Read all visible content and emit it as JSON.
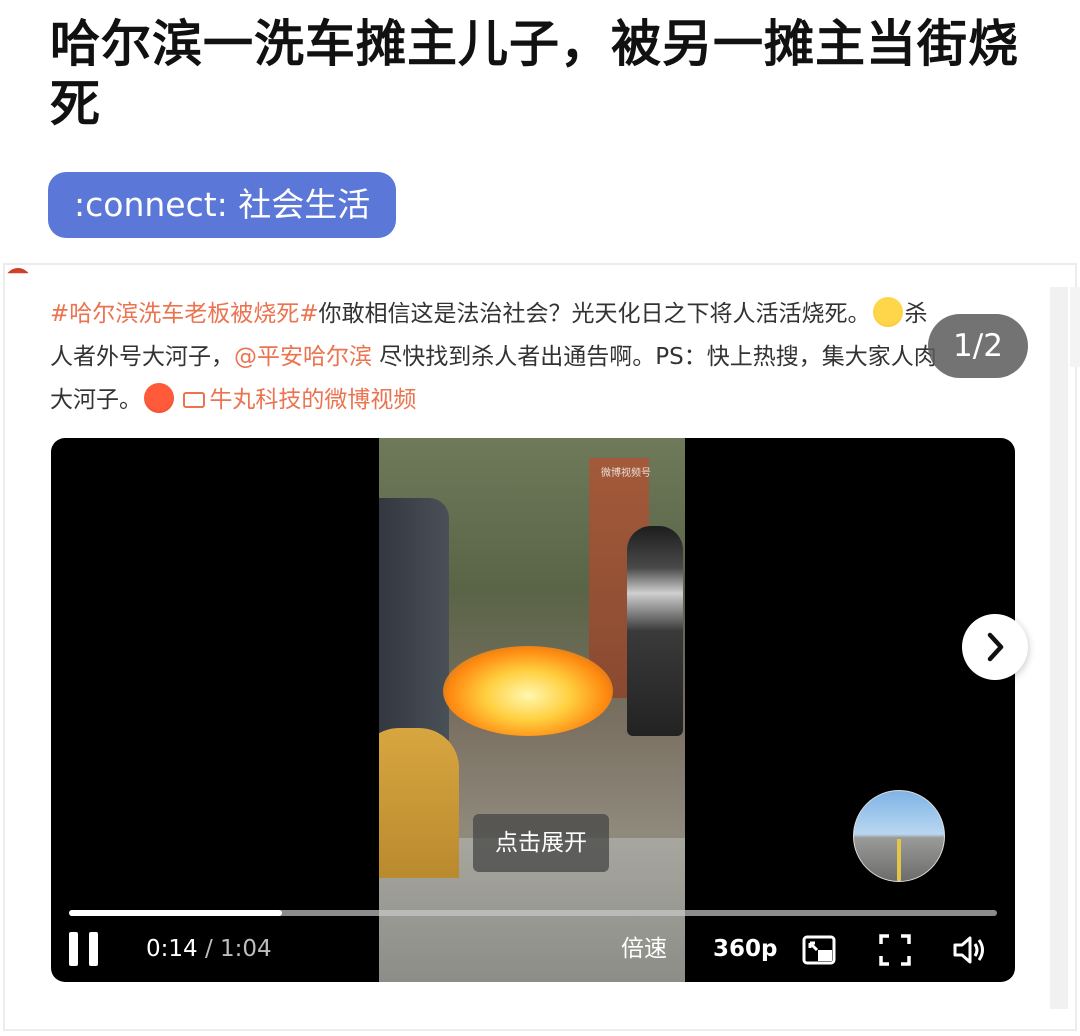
{
  "article": {
    "title": "哈尔滨一洗车摊主儿子，被另一摊主当街烧死",
    "tag_label": ":connect: 社会生活"
  },
  "post": {
    "hashtag": "#哈尔滨洗车老板被烧死#",
    "text_1": "你敢相信这是法治社会？光天化日之下将人活活烧死。",
    "emoji_1": "crying-face-emoji",
    "text_2": "杀人者外号大河子，",
    "mention": "@平安哈尔滨",
    "text_3": " 尽快找到杀人者出通告啊。PS：快上热搜，集大家人肉大河子。",
    "emoji_2": "angry-face-emoji",
    "video_source": "牛丸科技的微博视频"
  },
  "gallery": {
    "page_indicator": "1/2"
  },
  "video": {
    "expand_label": "点击展开",
    "current_time": "0:14",
    "separator": " / ",
    "duration": "1:04",
    "progress_fraction": 0.23,
    "speed_label": "倍速",
    "quality_label": "360p",
    "watermark": "微博视频号"
  },
  "colors": {
    "tag_bg": "#5b78d8",
    "link": "#eb7350",
    "title": "#111111"
  }
}
